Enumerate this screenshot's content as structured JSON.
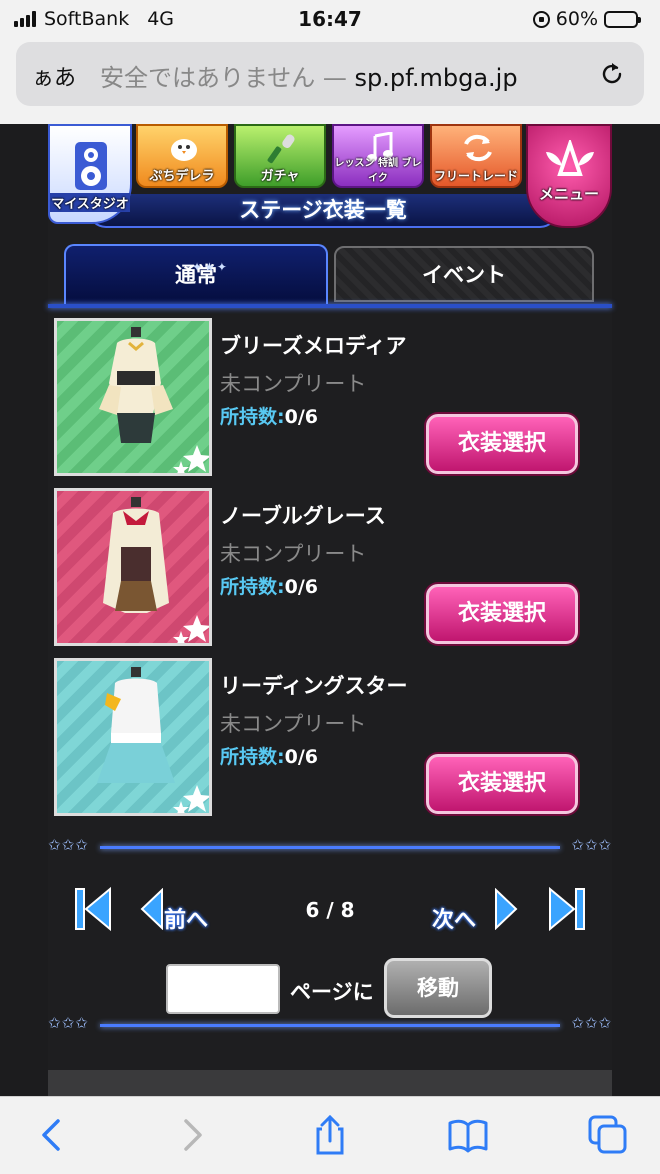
{
  "status_bar": {
    "carrier": "SoftBank",
    "network": "4G",
    "time": "16:47",
    "battery_text": "60%",
    "battery_level": 0.6
  },
  "browser": {
    "text_size_label": "ぁあ",
    "url_prefix": "安全ではありません — ",
    "url": "sp.pf.mbga.jp",
    "reload_icon": "reload-icon"
  },
  "nav": {
    "items": [
      {
        "label": "マイスタジオ",
        "icon": "speaker-icon"
      },
      {
        "label": "ぷちデレラ",
        "icon": "bird-icon"
      },
      {
        "label": "ガチャ",
        "icon": "microphone-icon"
      },
      {
        "label": "レッスン 特訓 ブレイク",
        "icon": "music-note-icon"
      },
      {
        "label": "フリートレード",
        "icon": "trade-arrows-icon"
      },
      {
        "label": "メニュー",
        "icon": "winged-logo-icon"
      }
    ],
    "page_title": "ステージ衣装一覧"
  },
  "tabs": {
    "normal": "通常",
    "event": "イベント",
    "active": "通常"
  },
  "costumes": [
    {
      "name": "ブリーズメロディア",
      "status": "未コンプリート",
      "owned_label": "所持数:",
      "owned_value": "0/6",
      "button": "衣装選択",
      "bg_color": "#6fcf8a"
    },
    {
      "name": "ノーブルグレース",
      "status": "未コンプリート",
      "owned_label": "所持数:",
      "owned_value": "0/6",
      "button": "衣装選択",
      "bg_color": "#e0587e"
    },
    {
      "name": "リーディングスター",
      "status": "未コンプリート",
      "owned_label": "所持数:",
      "owned_value": "0/6",
      "button": "衣装選択",
      "bg_color": "#7fd6d6"
    }
  ],
  "pager": {
    "prev": "前へ",
    "next": "次へ",
    "current": "6 / 8",
    "jump_label": "ページに",
    "jump_button": "移動",
    "jump_value": ""
  },
  "toolbar": {
    "icons": [
      "back-icon",
      "forward-icon",
      "share-icon",
      "bookmarks-icon",
      "tabs-icon"
    ]
  },
  "colors": {
    "accent_blue": "#4a7cff",
    "button_pink": "#e0359a",
    "owned_label": "#58c8f2"
  }
}
